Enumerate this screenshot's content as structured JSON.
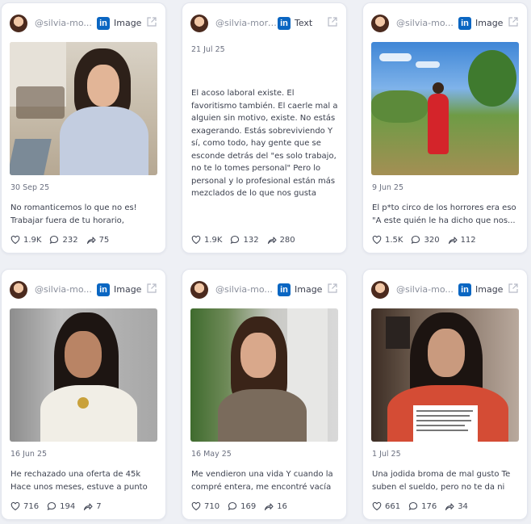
{
  "posts": [
    {
      "handle": "@silvia-mo...",
      "type": "Image",
      "date": "30 Sep 25",
      "excerpt": "No romanticemos lo que no es! Trabajar fuera de tu horario, quedart...",
      "likes": "1.9K",
      "comments": "232",
      "shares": "75"
    },
    {
      "handle": "@silvia-more...",
      "type": "Text",
      "date": "21 Jul 25",
      "excerpt": "El acoso laboral existe. El favoritismo también. El caerle mal a alguien sin motivo, existe. No estás exagerando. Estás sobreviviendo Y sí, como todo, hay gente que se esconde detrás del \"es solo trabajo, no te lo tomes personal\" Pero lo personal y lo profesional están más mezclados de lo que nos gusta admitir. Trabajas con personas. No con robots. Y todo lo qu...",
      "likes": "1.9K",
      "comments": "132",
      "shares": "280"
    },
    {
      "handle": "@silvia-mo...",
      "type": "Image",
      "date": "9 Jun 25",
      "excerpt": "El p*to circo de los horrores era eso \"A este quién le ha dicho que nos...",
      "likes": "1.5K",
      "comments": "320",
      "shares": "112"
    },
    {
      "handle": "@silvia-mo...",
      "type": "Image",
      "date": "16 Jun 25",
      "excerpt": "He rechazado una oferta de 45k Hace unos meses, estuve a punto de firmar...",
      "likes": "716",
      "comments": "194",
      "shares": "7"
    },
    {
      "handle": "@silvia-mo...",
      "type": "Image",
      "date": "16 May 25",
      "excerpt": "Me vendieron una vida Y cuando la compré entera, me encontré vacía M...",
      "likes": "710",
      "comments": "169",
      "shares": "16"
    },
    {
      "handle": "@silvia-mo...",
      "type": "Image",
      "date": "1 Jul 25",
      "excerpt": "Una jodida broma de mal gusto Te suben el sueldo, pero no te da ni para...",
      "likes": "661",
      "comments": "176",
      "shares": "34"
    }
  ],
  "platform_badge": "in",
  "icons": {
    "platform": "linkedin-icon",
    "open": "external-link-icon",
    "likes": "heart-icon",
    "comments": "comment-icon",
    "shares": "share-icon"
  },
  "colors": {
    "linkedin": "#0a66c2",
    "background": "#eef0f5",
    "card": "#ffffff"
  }
}
